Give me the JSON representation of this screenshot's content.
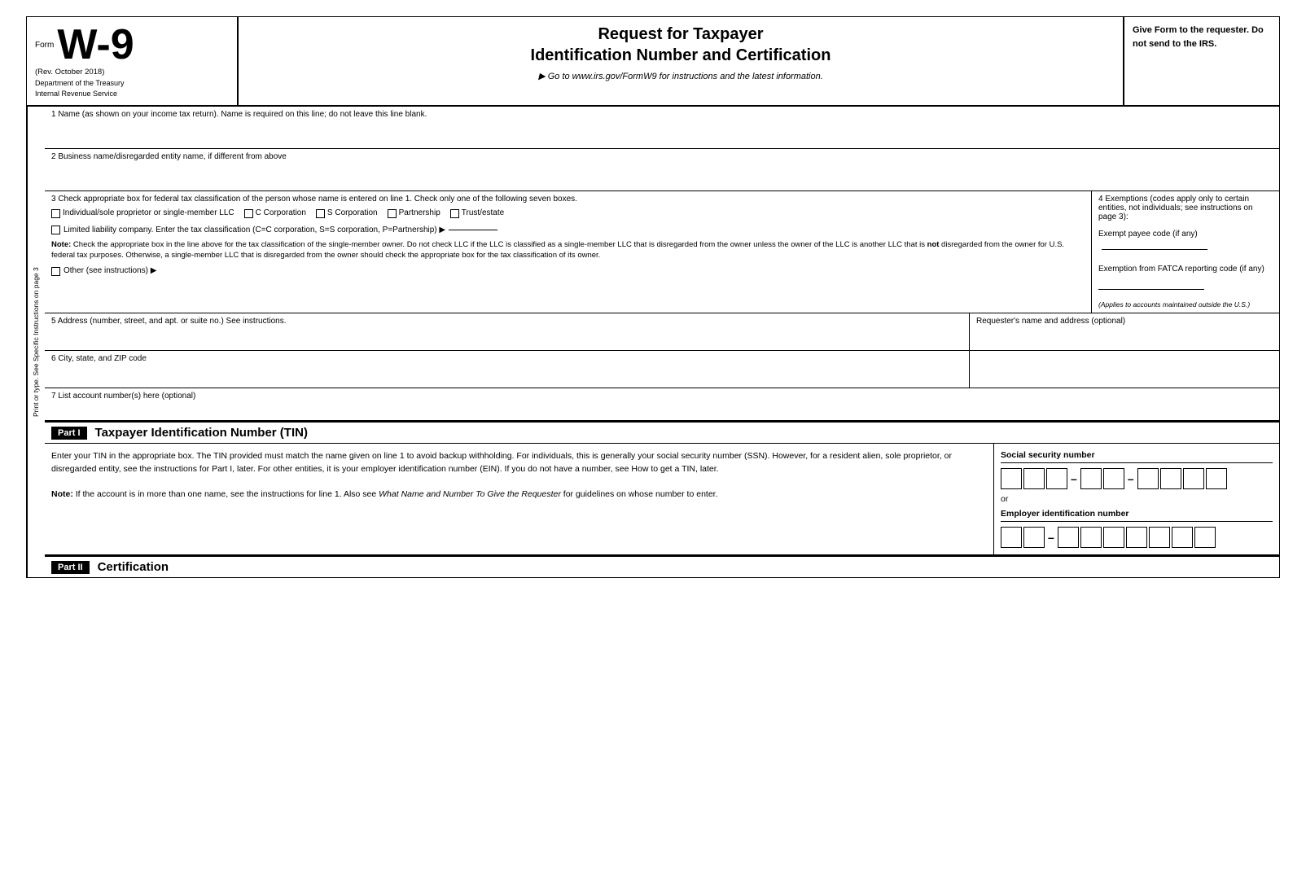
{
  "header": {
    "form_label": "Form",
    "form_number": "W-9",
    "rev_date": "(Rev. October 2018)",
    "dept_line1": "Department of the Treasury",
    "dept_line2": "Internal Revenue Service",
    "title_line1": "Request for Taxpayer",
    "title_line2": "Identification Number and Certification",
    "goto_text": "▶ Go to www.irs.gov/FormW9 for instructions and the latest information.",
    "give_form": "Give Form to the requester. Do not send to the IRS."
  },
  "sidebar": {
    "text": "Print or type. See Specific Instructions on page 3"
  },
  "fields": {
    "line1_label": "1  Name (as shown on your income tax return). Name is required on this line; do not leave this line blank.",
    "line2_label": "2  Business name/disregarded entity name, if different from above",
    "line3_label": "3  Check appropriate box for federal tax classification of the person whose name is entered on line 1. Check only one of the following seven boxes.",
    "checkbox_individual": "Individual/sole proprietor or single-member LLC",
    "checkbox_c_corp": "C Corporation",
    "checkbox_s_corp": "S Corporation",
    "checkbox_partnership": "Partnership",
    "checkbox_trust": "Trust/estate",
    "llc_label": "Limited liability company. Enter the tax classification (C=C corporation, S=S corporation, P=Partnership) ▶",
    "note_text": "Note: Check the appropriate box in the line above for the tax classification of the single-member owner. Do not check LLC if the LLC is classified as a single-member LLC that is disregarded from the owner unless the owner of the LLC is another LLC that is not disregarded from the owner for U.S. federal tax purposes. Otherwise, a single-member LLC that is disregarded from the owner should check the appropriate box for the tax classification of its owner.",
    "other_label": "Other (see instructions) ▶",
    "section4_title": "4  Exemptions (codes apply only to certain entities, not individuals; see instructions on page 3):",
    "exempt_payee_label": "Exempt payee code (if any)",
    "fatca_label": "Exemption from FATCA reporting code (if any)",
    "applies_text": "(Applies to accounts maintained outside the U.S.)",
    "line5_label": "5  Address (number, street, and apt. or suite no.) See instructions.",
    "requester_label": "Requester's name and address (optional)",
    "line6_label": "6  City, state, and ZIP code",
    "line7_label": "7  List account number(s) here (optional)"
  },
  "part1": {
    "label": "Part I",
    "title": "Taxpayer Identification Number (TIN)",
    "body_text": "Enter your TIN in the appropriate box. The TIN provided must match the name given on line 1 to avoid backup withholding. For individuals, this is generally your social security number (SSN). However, for a resident alien, sole proprietor, or disregarded entity, see the instructions for Part I, later. For other entities, it is your employer identification number (EIN). If you do not have a number, see How to get a TIN, later.",
    "note_text": "Note: If the account is in more than one name, see the instructions for line 1. Also see What Name and Number To Give the Requester for guidelines on whose number to enter.",
    "ssn_label": "Social security number",
    "ein_label": "Employer identification number"
  },
  "part2": {
    "label": "Part II",
    "title": "Certification"
  }
}
